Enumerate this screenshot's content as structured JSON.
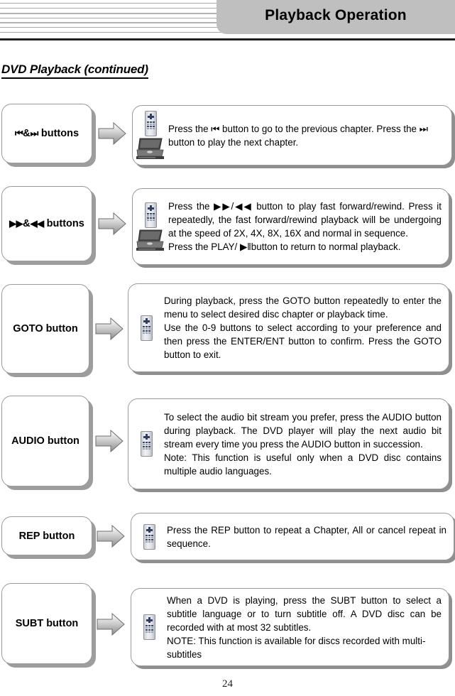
{
  "header": {
    "title": "Playback Operation",
    "accent_color": "#bfbfbf",
    "rule_color": "#231f20"
  },
  "section": {
    "title": "DVD Playback (continued)"
  },
  "rows": [
    {
      "label_prefix": "⏮",
      "label_amp": "&",
      "label_suffix": "⏭",
      "label_word": " buttons",
      "label_name": "prev-next-buttons",
      "devices": [
        "remote",
        "player"
      ],
      "paragraphs": [
        "Press the ⏮ button to go to the previous chapter. Press the ⏭ button to play the next chapter."
      ]
    },
    {
      "label_prefix": "▶▶",
      "label_amp": "&",
      "label_suffix": "◀◀",
      "label_word": " buttons",
      "label_name": "fast-forward-rewind-buttons",
      "devices": [
        "remote",
        "player"
      ],
      "paragraphs": [
        "Press the ▶▶/◀◀ button to play fast forward/rewind. Press it repeatedly, the fast forward/rewind playback will be undergoing at the speed of 2X, 4X, 8X, 16X and normal in sequence.",
        "Press the PLAY/ ▶‖button to return to normal playback."
      ]
    },
    {
      "label_word": "GOTO button",
      "label_name": "goto-button",
      "devices": [
        "remote"
      ],
      "paragraphs": [
        "During playback, press the GOTO button repeatedly to enter the menu to select desired disc chapter or playback time.",
        "Use the 0-9 buttons to select according to your preference and then press the ENTER/ENT button to confirm. Press the GOTO button to exit."
      ]
    },
    {
      "label_word": "AUDIO button",
      "label_name": "audio-button",
      "devices": [
        "remote"
      ],
      "paragraphs": [
        "To select the audio bit stream you prefer, press the AUDIO button during playback. The DVD player will play the next audio bit stream every time you press the AUDIO button in succession.",
        "Note: This function is useful only when a DVD disc contains multiple audio languages."
      ]
    },
    {
      "label_word": "REP button",
      "label_name": "rep-button",
      "devices": [
        "remote"
      ],
      "paragraphs": [
        "Press the REP button to repeat a Chapter, All or cancel repeat in sequence."
      ]
    },
    {
      "label_word": "SUBT button",
      "label_name": "subt-button",
      "devices": [
        "remote"
      ],
      "paragraphs": [
        "When a DVD is playing, press the SUBT button to select a subtitle language or to turn subtitle off. A DVD disc can be recorded with at most 32 subtitles.",
        "NOTE: This function is available for discs recorded with multi-subtitles"
      ]
    }
  ],
  "footer": {
    "page_number": "24"
  },
  "icons": {
    "arrow": "arrow-right-icon",
    "remote": "remote-control-icon",
    "player": "dvd-player-icon"
  }
}
